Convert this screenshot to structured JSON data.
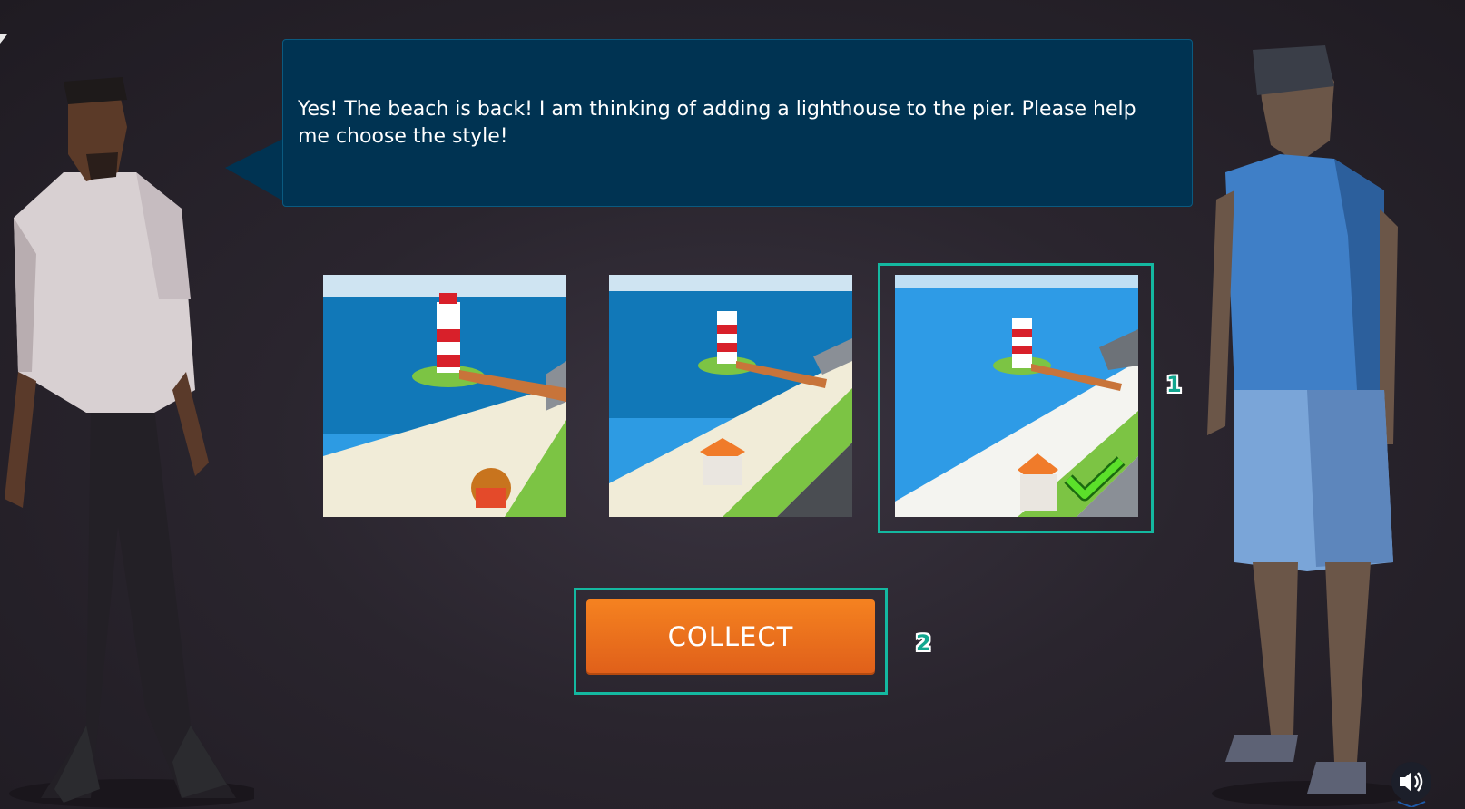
{
  "dialog": {
    "message": "Yes! The beach is back! I am thinking of adding a lighthouse to the pier. Please help me choose the style!"
  },
  "choices": [
    {
      "selected": false
    },
    {
      "selected": false
    },
    {
      "selected": true
    }
  ],
  "collect_button": {
    "label": "COLLECT"
  },
  "markers": {
    "first": "1",
    "second": "2"
  },
  "icons": {
    "selected_check": "checkmark-icon",
    "sound": "speaker-icon"
  },
  "colors": {
    "dialog_bg": "#003352",
    "highlight": "#14b8a0",
    "button": "#f26b1d",
    "checkmark": "#5be02a"
  }
}
